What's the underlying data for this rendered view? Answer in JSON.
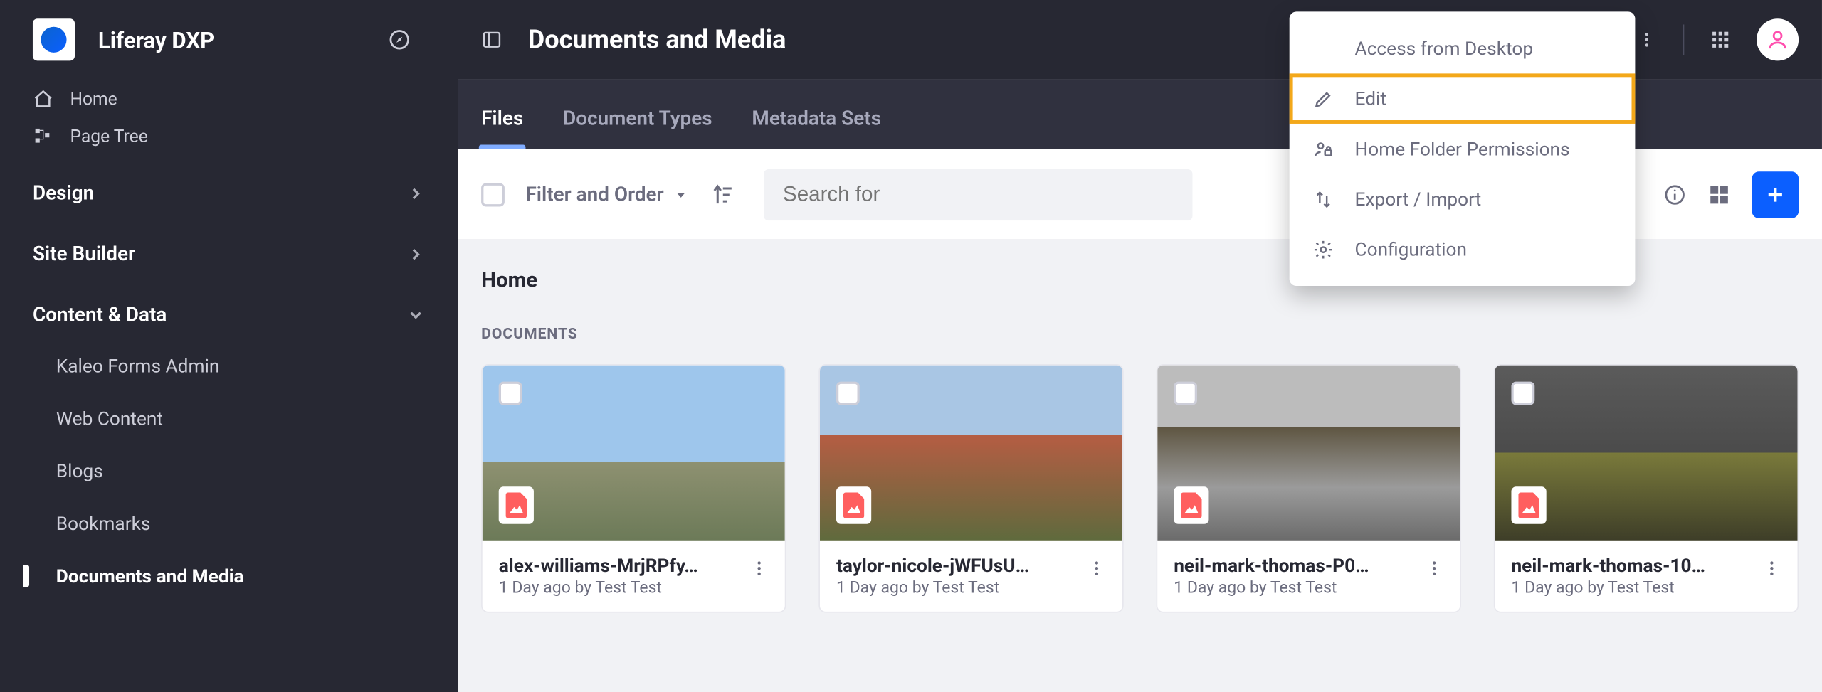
{
  "brand": {
    "title": "Liferay DXP"
  },
  "sidebar": {
    "quick": [
      {
        "label": "Home"
      },
      {
        "label": "Page Tree"
      }
    ],
    "sections": [
      {
        "label": "Design",
        "expanded": false
      },
      {
        "label": "Site Builder",
        "expanded": false
      },
      {
        "label": "Content & Data",
        "expanded": true
      }
    ],
    "contentItems": [
      {
        "label": "Kaleo Forms Admin"
      },
      {
        "label": "Web Content"
      },
      {
        "label": "Blogs"
      },
      {
        "label": "Bookmarks"
      },
      {
        "label": "Documents and Media",
        "active": true
      }
    ]
  },
  "header": {
    "title": "Documents and Media"
  },
  "tabs": [
    {
      "label": "Files",
      "active": true
    },
    {
      "label": "Document Types"
    },
    {
      "label": "Metadata Sets"
    }
  ],
  "toolbar": {
    "filter_label": "Filter and Order",
    "search_placeholder": "Search for"
  },
  "breadcrumb": {
    "current": "Home"
  },
  "section_label": "DOCUMENTS",
  "popover": {
    "items": [
      {
        "label": "Access from Desktop",
        "icon": null
      },
      {
        "label": "Edit",
        "icon": "pencil",
        "highlight": true
      },
      {
        "label": "Home Folder Permissions",
        "icon": "user-lock"
      },
      {
        "label": "Export / Import",
        "icon": "transfer"
      },
      {
        "label": "Configuration",
        "icon": "gear"
      }
    ]
  },
  "documents": [
    {
      "title": "alex-williams-MrjRPfy…",
      "meta": "1 Day ago by Test Test"
    },
    {
      "title": "taylor-nicole-jWFUsU…",
      "meta": "1 Day ago by Test Test"
    },
    {
      "title": "neil-mark-thomas-P0…",
      "meta": "1 Day ago by Test Test"
    },
    {
      "title": "neil-mark-thomas-10…",
      "meta": "1 Day ago by Test Test"
    }
  ]
}
